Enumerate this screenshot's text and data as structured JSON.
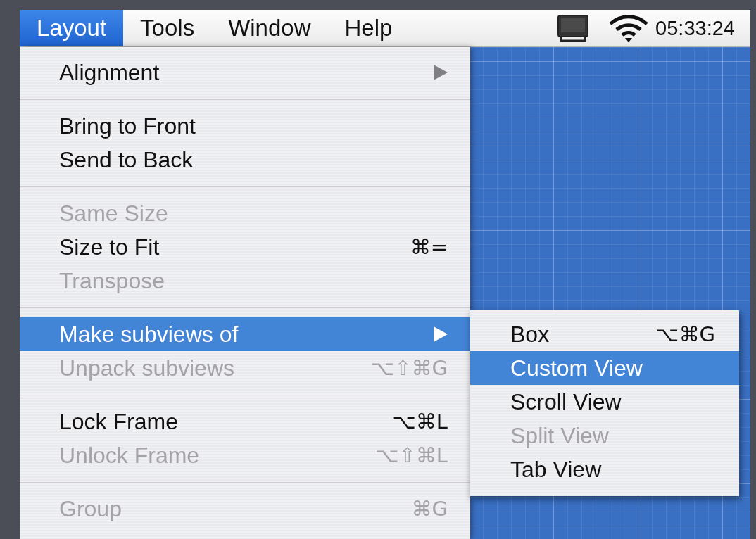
{
  "menu_bar": {
    "menus": [
      {
        "label": "Layout",
        "selected": true
      },
      {
        "label": "Tools",
        "selected": false
      },
      {
        "label": "Window",
        "selected": false
      },
      {
        "label": "Help",
        "selected": false
      }
    ],
    "clock": "05:33:24"
  },
  "menu": {
    "items": [
      {
        "kind": "item",
        "label": "Alignment",
        "disabled": false,
        "selected": false,
        "submenu": true
      },
      {
        "kind": "separator"
      },
      {
        "kind": "item",
        "label": "Bring to Front",
        "disabled": false,
        "selected": false
      },
      {
        "kind": "item",
        "label": "Send to Back",
        "disabled": false,
        "selected": false
      },
      {
        "kind": "separator"
      },
      {
        "kind": "item",
        "label": "Same Size",
        "disabled": true,
        "selected": false
      },
      {
        "kind": "item",
        "label": "Size to Fit",
        "shortcut": "⌘=",
        "disabled": false,
        "selected": false
      },
      {
        "kind": "item",
        "label": "Transpose",
        "disabled": true,
        "selected": false
      },
      {
        "kind": "separator"
      },
      {
        "kind": "item",
        "label": "Make subviews of",
        "disabled": false,
        "selected": true,
        "submenu": true
      },
      {
        "kind": "item",
        "label": "Unpack subviews",
        "shortcut": "⌥⇧⌘G",
        "disabled": true,
        "selected": false
      },
      {
        "kind": "separator"
      },
      {
        "kind": "item",
        "label": "Lock Frame",
        "shortcut": "⌥⌘L",
        "disabled": false,
        "selected": false
      },
      {
        "kind": "item",
        "label": "Unlock Frame",
        "shortcut": "⌥⇧⌘L",
        "disabled": true,
        "selected": false
      },
      {
        "kind": "separator"
      },
      {
        "kind": "item",
        "label": "Group",
        "shortcut": "⌘G",
        "disabled": true,
        "selected": false
      }
    ]
  },
  "submenu": {
    "items": [
      {
        "kind": "item",
        "label": "Box",
        "shortcut": "⌥⌘G",
        "disabled": false,
        "selected": false
      },
      {
        "kind": "item",
        "label": "Custom View",
        "disabled": false,
        "selected": true
      },
      {
        "kind": "item",
        "label": "Scroll View",
        "disabled": false,
        "selected": false
      },
      {
        "kind": "item",
        "label": "Split View",
        "disabled": true,
        "selected": false
      },
      {
        "kind": "item",
        "label": "Tab View",
        "disabled": false,
        "selected": false
      }
    ]
  }
}
